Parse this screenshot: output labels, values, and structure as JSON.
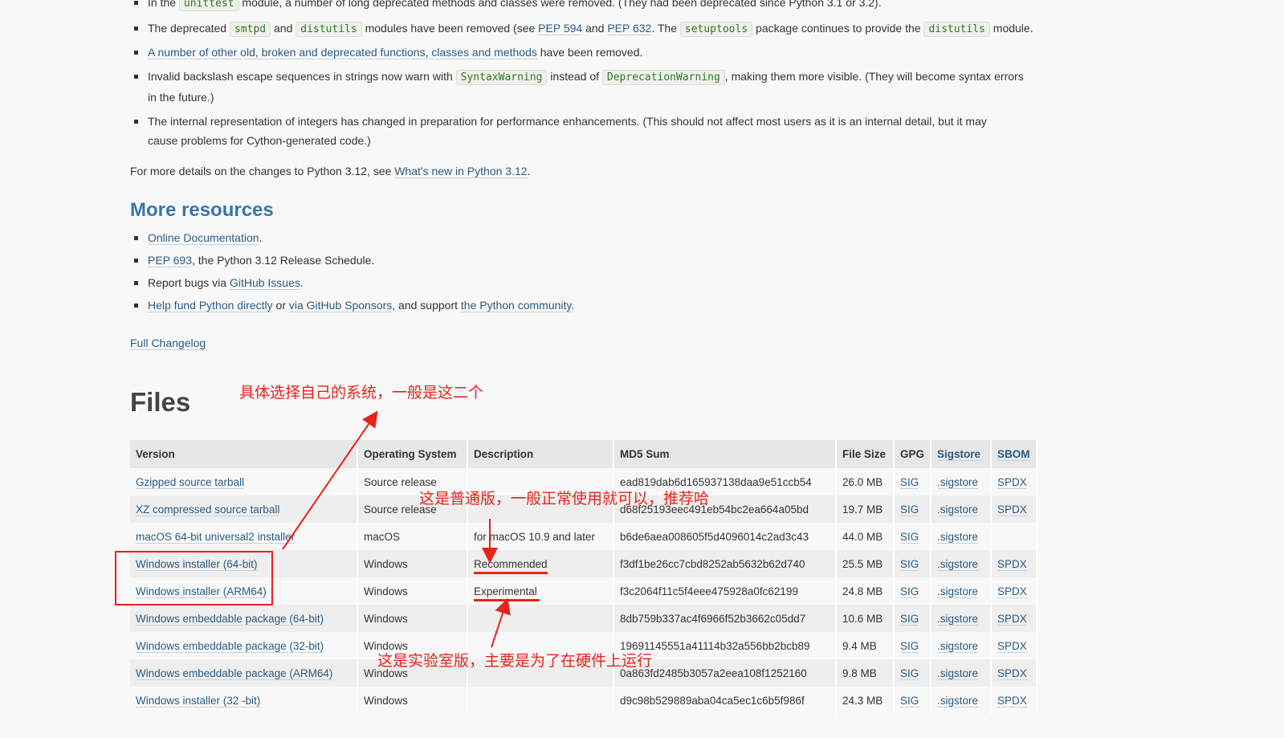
{
  "notes": {
    "item0": {
      "pre": "In the ",
      "code": "unittest",
      "post": " module, a number of long deprecated methods and classes were removed. (They had been deprecated since Python 3.1 or 3.2)."
    },
    "item1": {
      "t1": "The deprecated ",
      "c1": "smtpd",
      "t2": " and ",
      "c2": "distutils",
      "t3": " modules have been removed (see ",
      "l1": "PEP 594",
      "t4": " and ",
      "l2": "PEP 632",
      "t5": ". The ",
      "c3": "setuptools",
      "t6": " package continues to provide the ",
      "c4": "distutils",
      "t7": " module."
    },
    "item2": {
      "link": "A number of other old, broken and deprecated functions, classes and methods",
      "post": " have been removed."
    },
    "item3": {
      "t1": "Invalid backslash escape sequences in strings now warn with ",
      "c1": "SyntaxWarning",
      "t2": " instead of ",
      "c2": "DeprecationWarning",
      "t3": ", making them more visible. (They will become syntax errors in the future.)"
    },
    "item4": {
      "text": "The internal representation of integers has changed in preparation for performance enhancements. (This should not affect most users as it is an internal detail, but it may cause problems for Cython-generated code.)"
    },
    "more_details": {
      "pre": "For more details on the changes to Python 3.12, see ",
      "link": "What's new in Python 3.12",
      "post": "."
    }
  },
  "resources": {
    "heading": "More resources",
    "item0": {
      "link": "Online Documentation",
      "post": "."
    },
    "item1": {
      "link": "PEP 693",
      "post": ", the Python 3.12 Release Schedule."
    },
    "item2": {
      "pre": "Report bugs via ",
      "link": "GitHub Issues",
      "post": "."
    },
    "item3": {
      "link1": "Help fund Python directly",
      "mid1": " or ",
      "link2": "via GitHub Sponsors",
      "mid2": ", and support ",
      "link3": "the Python community",
      "post": "."
    },
    "changelog": "Full Changelog"
  },
  "files": {
    "heading": "Files",
    "columns": [
      "Version",
      "Operating System",
      "Description",
      "MD5 Sum",
      "File Size",
      "GPG",
      "Sigstore",
      "SBOM"
    ],
    "rows": [
      {
        "version": "Gzipped source tarball",
        "os": "Source release",
        "desc": "",
        "md5": "ead819dab6d165937138daa9e51ccb54",
        "size": "26.0 MB",
        "gpg": "SIG",
        "sigstore": ".sigstore",
        "sbom": "SPDX"
      },
      {
        "version": "XZ compressed source tarball",
        "os": "Source release",
        "desc": "",
        "md5": "d68f25193eec491eb54bc2ea664a05bd",
        "size": "19.7 MB",
        "gpg": "SIG",
        "sigstore": ".sigstore",
        "sbom": "SPDX"
      },
      {
        "version": "macOS 64-bit universal2 installer",
        "os": "macOS",
        "desc": "for macOS 10.9 and later",
        "md5": "b6de6aea008605f5d4096014c2ad3c43",
        "size": "44.0 MB",
        "gpg": "SIG",
        "sigstore": ".sigstore",
        "sbom": ""
      },
      {
        "version": "Windows installer (64-bit)",
        "os": "Windows",
        "desc": "Recommended",
        "md5": "f3df1be26cc7cbd8252ab5632b62d740",
        "size": "25.5 MB",
        "gpg": "SIG",
        "sigstore": ".sigstore",
        "sbom": "SPDX"
      },
      {
        "version": "Windows installer (ARM64)",
        "os": "Windows",
        "desc": "Experimental",
        "md5": "f3c2064f11c5f4eee475928a0fc62199",
        "size": "24.8 MB",
        "gpg": "SIG",
        "sigstore": ".sigstore",
        "sbom": "SPDX"
      },
      {
        "version": "Windows embeddable package (64-bit)",
        "os": "Windows",
        "desc": "",
        "md5": "8db759b337ac4f6966f52b3662c05dd7",
        "size": "10.6 MB",
        "gpg": "SIG",
        "sigstore": ".sigstore",
        "sbom": "SPDX"
      },
      {
        "version": "Windows embeddable package (32-bit)",
        "os": "Windows",
        "desc": "",
        "md5": "19691145551a41114b32a556bb2bcb89",
        "size": "9.4 MB",
        "gpg": "SIG",
        "sigstore": ".sigstore",
        "sbom": "SPDX"
      },
      {
        "version": "Windows embeddable package (ARM64)",
        "os": "Windows",
        "desc": "",
        "md5": "0a863fd2485b3057a2eea108f1252160",
        "size": "9.8 MB",
        "gpg": "SIG",
        "sigstore": ".sigstore",
        "sbom": "SPDX"
      },
      {
        "version": "Windows installer (32 -bit)",
        "os": "Windows",
        "desc": "",
        "md5": "d9c98b529889aba04ca5ec1c6b5f986f",
        "size": "24.3 MB",
        "gpg": "SIG",
        "sigstore": ".sigstore",
        "sbom": "SPDX"
      }
    ]
  },
  "annotations": {
    "choose": "具体选择自己的系统，一般是这二个",
    "normal": "这是普通版，一般正常使用就可以，推荐哈",
    "experimental": "这是实验室版，主要是为了在硬件上运行"
  },
  "colors": {
    "link": "#2b5b84",
    "heading": "#3776ab",
    "annotation": "#e8231a"
  }
}
